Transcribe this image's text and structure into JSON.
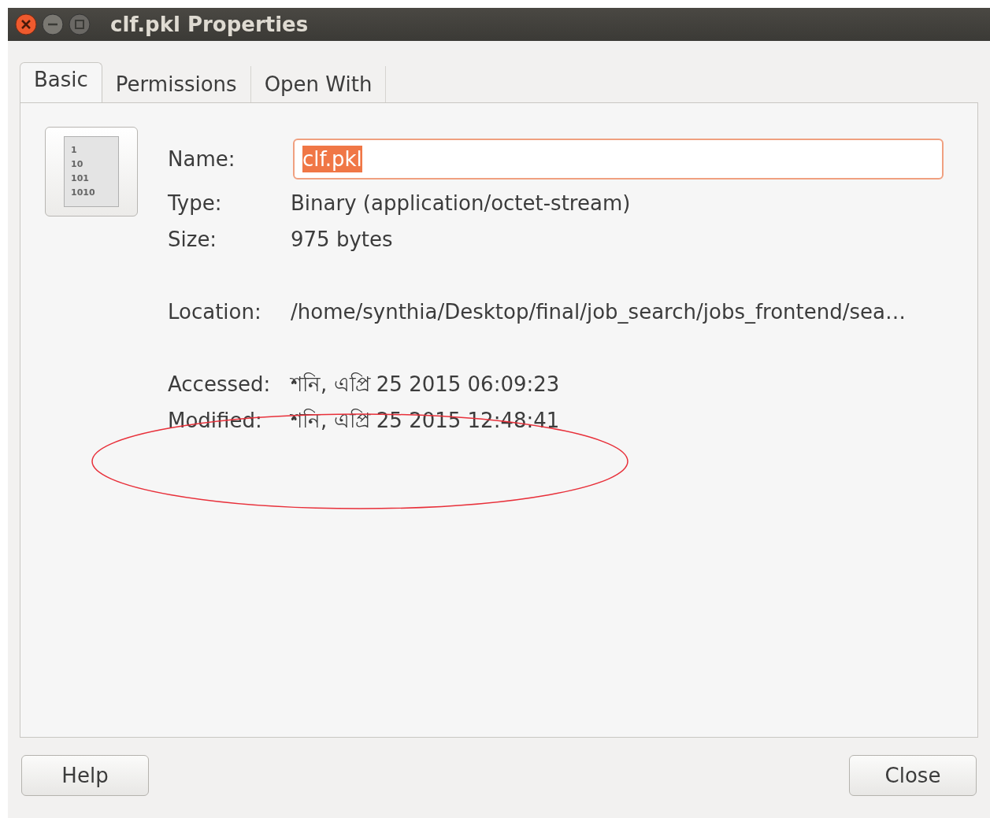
{
  "window": {
    "title": "clf.pkl Properties"
  },
  "tabs": [
    {
      "label": "Basic",
      "selected": true
    },
    {
      "label": "Permissions",
      "selected": false
    },
    {
      "label": "Open With",
      "selected": false
    }
  ],
  "file_icon": {
    "lines": [
      "1",
      "10",
      "101",
      "1010"
    ]
  },
  "fields": [
    {
      "kind": "input",
      "label": "Name:",
      "value": "clf.pkl",
      "selected": true
    },
    {
      "kind": "text",
      "label": "Type:",
      "value": "Binary (application/octet-stream)"
    },
    {
      "kind": "text",
      "label": "Size:",
      "value": "975 bytes"
    },
    {
      "kind": "gap"
    },
    {
      "kind": "text",
      "label": "Location:",
      "value": "/home/synthia/Desktop/final/job_search/jobs_frontend/sea…"
    },
    {
      "kind": "gap"
    },
    {
      "kind": "text",
      "label": "Accessed:",
      "value": "শনি, এপ্রি 25 2015 06:09:23"
    },
    {
      "kind": "text",
      "label": "Modified:",
      "value": "শনি, এপ্রি 25 2015 12:48:41"
    }
  ],
  "annotation": {
    "kind": "ellipse"
  },
  "buttons": [
    "Help",
    "Close"
  ]
}
